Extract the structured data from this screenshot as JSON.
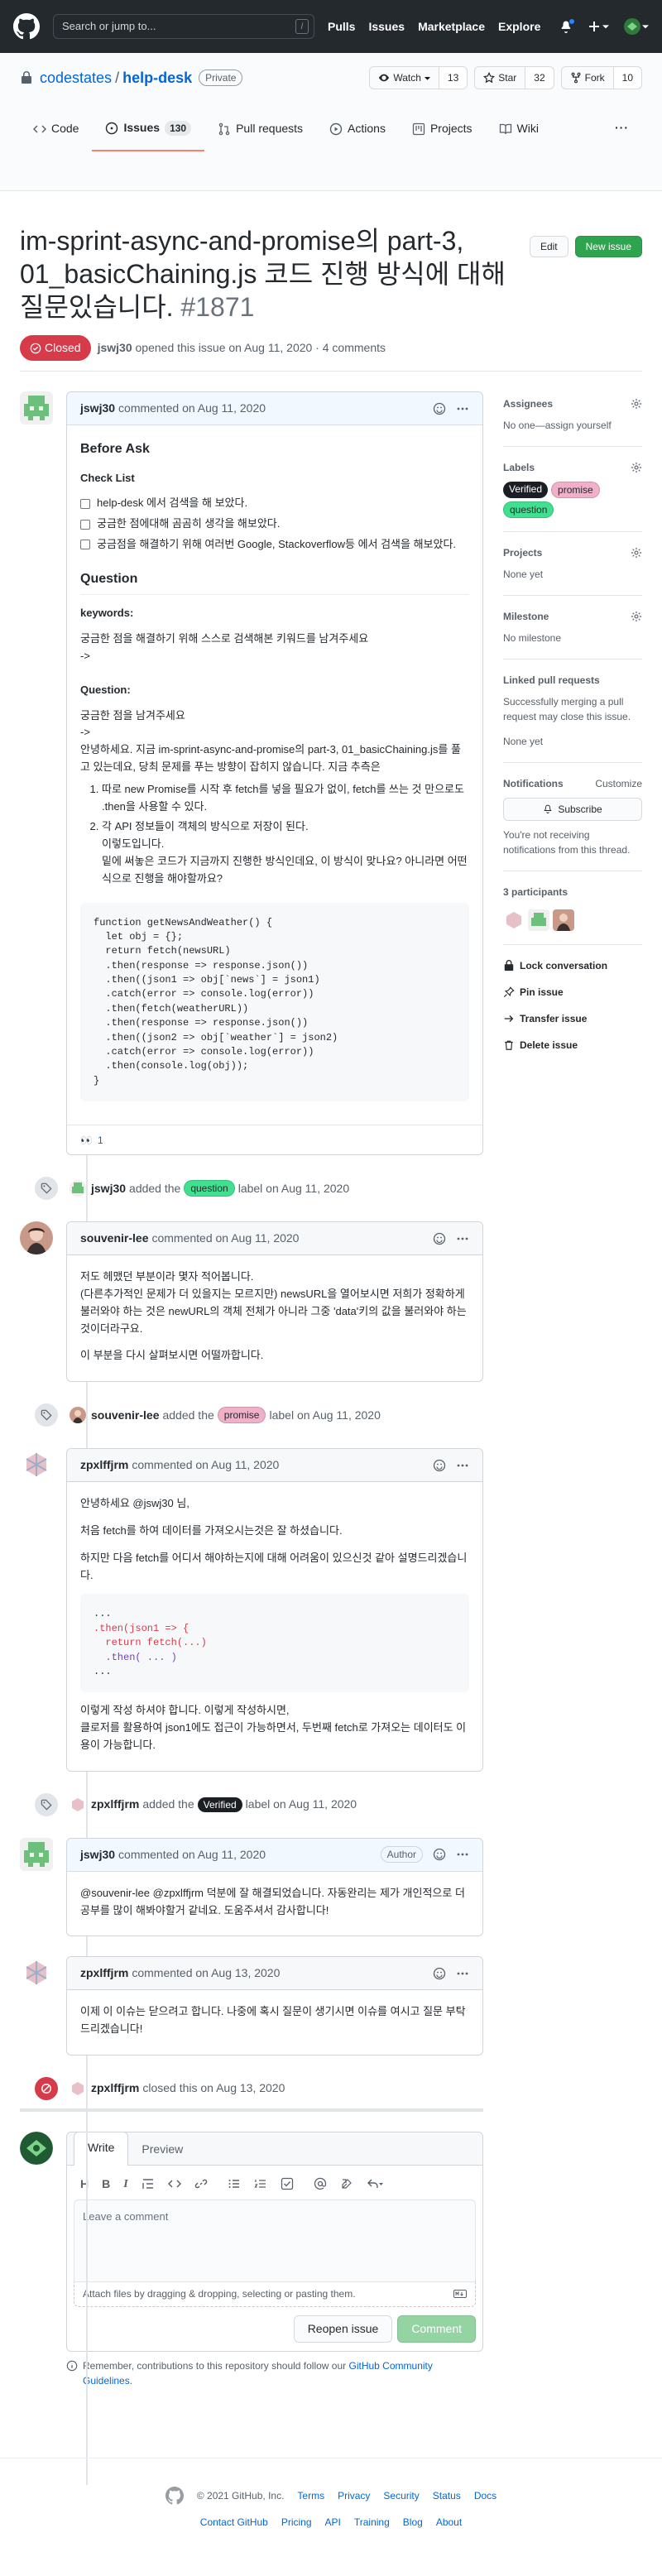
{
  "header": {
    "search_placeholder": "Search or jump to...",
    "search_key": "/",
    "nav": [
      "Pulls",
      "Issues",
      "Marketplace",
      "Explore"
    ]
  },
  "repo": {
    "owner": "codestates",
    "separator": "/",
    "name": "help-desk",
    "visibility": "Private",
    "watch_label": "Watch",
    "watch_count": "13",
    "star_label": "Star",
    "star_count": "32",
    "fork_label": "Fork",
    "fork_count": "10",
    "tabs": [
      {
        "label": "Code",
        "count": ""
      },
      {
        "label": "Issues",
        "count": "130"
      },
      {
        "label": "Pull requests",
        "count": ""
      },
      {
        "label": "Actions",
        "count": ""
      },
      {
        "label": "Projects",
        "count": ""
      },
      {
        "label": "Wiki",
        "count": ""
      }
    ],
    "more": "···"
  },
  "issue": {
    "title": "im-sprint-async-and-promise의 part-3, 01_basicChaining.js 코드 진행 방식에 대해 질문있습니다.",
    "number": "#1871",
    "edit_label": "Edit",
    "new_issue_label": "New issue",
    "state": "Closed",
    "author": "jswj30",
    "opened_text": "opened this issue on Aug 11, 2020 · 4 comments"
  },
  "comments": [
    {
      "author": "jswj30",
      "meta": "commented on Aug 11, 2020",
      "heading": "Before Ask",
      "checklist_title": "Check List",
      "checklist": [
        "help-desk 에서 검색을 해 보았다.",
        "궁금한 점에대해 곰곰히 생각을 해보았다.",
        "궁금점을 해결하기 위해 여러번 Google, Stackoverflow등 에서 검색을 해보았다."
      ],
      "question_heading": "Question",
      "keywords_label": "keywords:",
      "keywords_text": "궁금한 점을 해결하기 위해 스스로 검색해본 키워드를 남겨주세요",
      "keywords_arrow": "->",
      "question_label": "Question:",
      "question_line1": "궁금한 점을 남겨주세요",
      "question_arrow": "->",
      "question_body": "안녕하세요. 지금 im-sprint-async-and-promise의 part-3, 01_basicChaining.js를 풀고 있는데요, 당최 문제를 푸는 방향이 잡히지 않습니다. 지금 추측은",
      "list": [
        "따로 new Promise를 시작 후 fetch를 넣을 필요가 없이, fetch를 쓰는 것 만으로도 .then을 사용할 수 있다.",
        "각 API 정보들이 객체의 방식으로 저장이 된다.\n이렇도입니다.\n밑에 써놓은 코드가 지금까지 진행한 방식인데요, 이 방식이 맞나요? 아니라면 어떤 식으로 진행을 해야할까요?"
      ],
      "code": "function getNewsAndWeather() {\n  let obj = {};\n  return fetch(newsURL)\n  .then(response => response.json())\n  .then((json1 => obj[`news`] = json1)\n  .catch(error => console.log(error))\n  .then(fetch(weatherURL))\n  .then(response => response.json())\n  .then((json2 => obj[`weather`] = json2)\n  .catch(error => console.log(error))\n  .then(console.log(obj));\n}",
      "reaction": "👀",
      "reaction_count": "1"
    },
    {
      "author": "souvenir-lee",
      "meta": "commented on Aug 11, 2020",
      "p1": "저도 헤맸던 부분이라 몇자 적어봅니다.\n(다른추가적인 문제가 더 있을지는 모르지만) newsURL을 열어보시면 저희가 정확하게 불러와야 하는 것은 newURL의 객체 전체가 아니라 그중 'data'키의 값을 불러와야 하는 것이더라구요.",
      "p2": "이 부분을 다시 살펴보시면 어떨까합니다."
    },
    {
      "author": "zpxlffjrm",
      "meta": "commented on Aug 11, 2020",
      "p1": "안녕하세요 @jswj30 님,",
      "p2": "처음 fetch를 하여 데이터를 가져오시는것은 잘 하셨습니다.",
      "p3": "하지만 다음 fetch를 어디서 해야하는지에 대해 어려움이 있으신것 같아 설명드리겠습니다.",
      "code_l1": "...",
      "code_l2": ".then(json1 => {",
      "code_l3": "  return fetch(...)",
      "code_l4": "  .then( ... )",
      "code_l5": "...",
      "p4": "이렇게 작성 하셔야 합니다. 이렇게 작성하시면,\n클로저를 활용하여 json1에도 접근이 가능하면서, 두번째 fetch로 가져오는 데이터도 이용이 가능합니다."
    },
    {
      "author": "jswj30",
      "meta": "commented on Aug 11, 2020",
      "badge": "Author",
      "p1": "@souvenir-lee @zpxlffjrm 덕분에 잘 해결되었습니다. 자동완리는 제가 개인적으로 더 공부를 많이 해봐야할거 같네요. 도움주셔서 감사합니다!"
    },
    {
      "author": "zpxlffjrm",
      "meta": "commented on Aug 13, 2020",
      "p1": "이제 이 이슈는 닫으려고 합니다. 나중에 혹시 질문이 생기시면 이슈를 여시고 질문 부탁드리겠습니다!"
    }
  ],
  "events": [
    {
      "actor": "jswj30",
      "pre": "added the",
      "label": "question",
      "post": "label on Aug 11, 2020",
      "label_bg": "#40e090",
      "label_fg": "#24292e"
    },
    {
      "actor": "souvenir-lee",
      "pre": "added the",
      "label": "promise",
      "post": "label on Aug 11, 2020",
      "label_bg": "#f0b0c8",
      "label_fg": "#24292e"
    },
    {
      "actor": "zpxlffjrm",
      "pre": "added the",
      "label": "Verified",
      "post": "label on Aug 11, 2020",
      "label_bg": "#1b1f23",
      "label_fg": "#ffffff"
    },
    {
      "actor": "zpxlffjrm",
      "text": "closed this on Aug 13, 2020"
    }
  ],
  "new_comment": {
    "tab_write": "Write",
    "tab_preview": "Preview",
    "toolbar": [
      "H",
      "B",
      "I"
    ],
    "placeholder": "Leave a comment",
    "attach": "Attach files by dragging & dropping, selecting or pasting them.",
    "reopen": "Reopen issue",
    "submit": "Comment",
    "tip_pre": "Remember, contributions to this repository should follow our",
    "tip_link": "GitHub Community Guidelines",
    "tip_post": "."
  },
  "sidebar": {
    "assignees_title": "Assignees",
    "assignees_value": "No one—assign yourself",
    "labels_title": "Labels",
    "labels": [
      {
        "name": "Verified",
        "bg": "#1b1f23",
        "fg": "#ffffff"
      },
      {
        "name": "promise",
        "bg": "#f0b0c8",
        "fg": "#24292e"
      },
      {
        "name": "question",
        "bg": "#40e090",
        "fg": "#24292e"
      }
    ],
    "projects_title": "Projects",
    "projects_value": "None yet",
    "milestone_title": "Milestone",
    "milestone_value": "No milestone",
    "linked_title": "Linked pull requests",
    "linked_text": "Successfully merging a pull request may close this issue.",
    "linked_value": "None yet",
    "notifications_title": "Notifications",
    "customize": "Customize",
    "subscribe": "Subscribe",
    "notif_text": "You're not receiving notifications from this thread.",
    "participants": "3 participants",
    "actions": [
      "Lock conversation",
      "Pin issue",
      "Transfer issue",
      "Delete issue"
    ]
  },
  "footer": {
    "copyright": "© 2021 GitHub, Inc.",
    "row1": [
      "Terms",
      "Privacy",
      "Security",
      "Status",
      "Docs"
    ],
    "row2": [
      "Contact GitHub",
      "Pricing",
      "API",
      "Training",
      "Blog",
      "About"
    ]
  }
}
